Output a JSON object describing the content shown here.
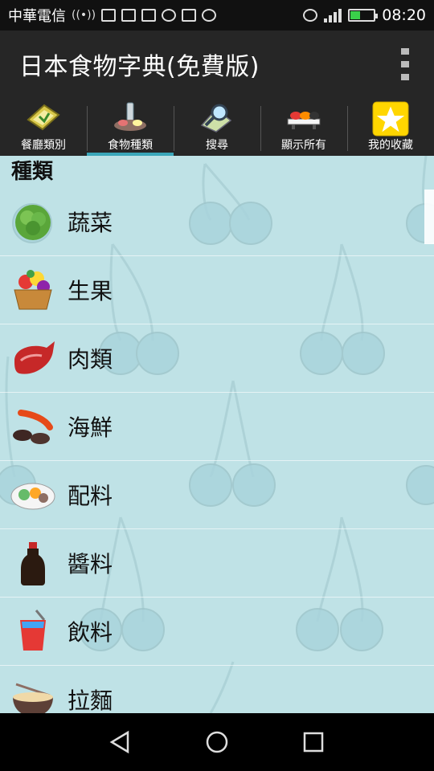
{
  "status": {
    "carrier": "中華電信",
    "time": "08:20"
  },
  "app": {
    "title": "日本食物字典(免費版)"
  },
  "tabs": [
    {
      "label": "餐廳類別",
      "icon": "restaurant-icon"
    },
    {
      "label": "食物種類",
      "icon": "food-types-icon",
      "active": true
    },
    {
      "label": "搜尋",
      "icon": "search-icon"
    },
    {
      "label": "顯示所有",
      "icon": "sushi-icon"
    },
    {
      "label": "我的收藏",
      "icon": "star-icon"
    }
  ],
  "section_title": "種類",
  "items": [
    {
      "label": "蔬菜",
      "icon": "vegetable-icon"
    },
    {
      "label": "生果",
      "icon": "fruit-basket-icon"
    },
    {
      "label": "肉類",
      "icon": "meat-icon"
    },
    {
      "label": "海鮮",
      "icon": "seafood-icon"
    },
    {
      "label": "配料",
      "icon": "ingredients-icon"
    },
    {
      "label": "醬料",
      "icon": "soy-sauce-icon"
    },
    {
      "label": "飲料",
      "icon": "drink-icon"
    },
    {
      "label": "拉麵",
      "icon": "ramen-icon"
    }
  ],
  "colors": {
    "content_bg": "#bfe2e6",
    "bar_bg": "#262626",
    "accent": "#3aa6b9"
  }
}
